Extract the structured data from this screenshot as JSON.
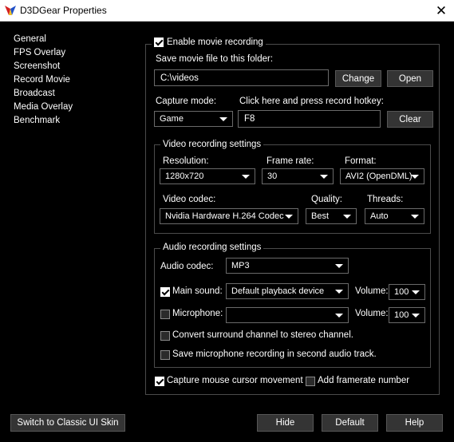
{
  "window": {
    "title": "D3DGear Properties"
  },
  "sidebar": {
    "items": [
      {
        "label": "General"
      },
      {
        "label": "FPS Overlay"
      },
      {
        "label": "Screenshot"
      },
      {
        "label": "Record Movie"
      },
      {
        "label": "Broadcast"
      },
      {
        "label": "Media Overlay"
      },
      {
        "label": "Benchmark"
      }
    ]
  },
  "record": {
    "enable_label": "Enable movie recording",
    "enable_checked": true,
    "folder_label": "Save movie file to this folder:",
    "folder_value": "C:\\videos",
    "change_label": "Change",
    "open_label": "Open",
    "capture_mode_label": "Capture mode:",
    "capture_mode_value": "Game",
    "hotkey_label": "Click here and press record hotkey:",
    "hotkey_value": "F8",
    "clear_label": "Clear"
  },
  "video": {
    "legend": "Video recording settings",
    "resolution_label": "Resolution:",
    "resolution_value": "1280x720",
    "framerate_label": "Frame rate:",
    "framerate_value": "30",
    "format_label": "Format:",
    "format_value": "AVI2 (OpenDML)",
    "codec_label": "Video codec:",
    "codec_value": "Nvidia Hardware H.264 Codec",
    "quality_label": "Quality:",
    "quality_value": "Best",
    "threads_label": "Threads:",
    "threads_value": "Auto"
  },
  "audio": {
    "legend": "Audio recording settings",
    "codec_label": "Audio codec:",
    "codec_value": "MP3",
    "main_sound_label": "Main sound:",
    "main_sound_checked": true,
    "main_sound_device": "Default playback device",
    "main_volume_label": "Volume:",
    "main_volume_value": "100",
    "mic_label": "Microphone:",
    "mic_checked": false,
    "mic_device": "",
    "mic_volume_label": "Volume:",
    "mic_volume_value": "100",
    "surround_label": "Convert surround channel to stereo channel.",
    "surround_checked": false,
    "second_track_label": "Save microphone recording in second audio track.",
    "second_track_checked": false
  },
  "options": {
    "cursor_label": "Capture mouse cursor movement",
    "cursor_checked": true,
    "framerate_number_label": "Add framerate number",
    "framerate_number_checked": false
  },
  "footer": {
    "classic_skin_label": "Switch to Classic UI Skin",
    "hide_label": "Hide",
    "default_label": "Default",
    "help_label": "Help"
  }
}
